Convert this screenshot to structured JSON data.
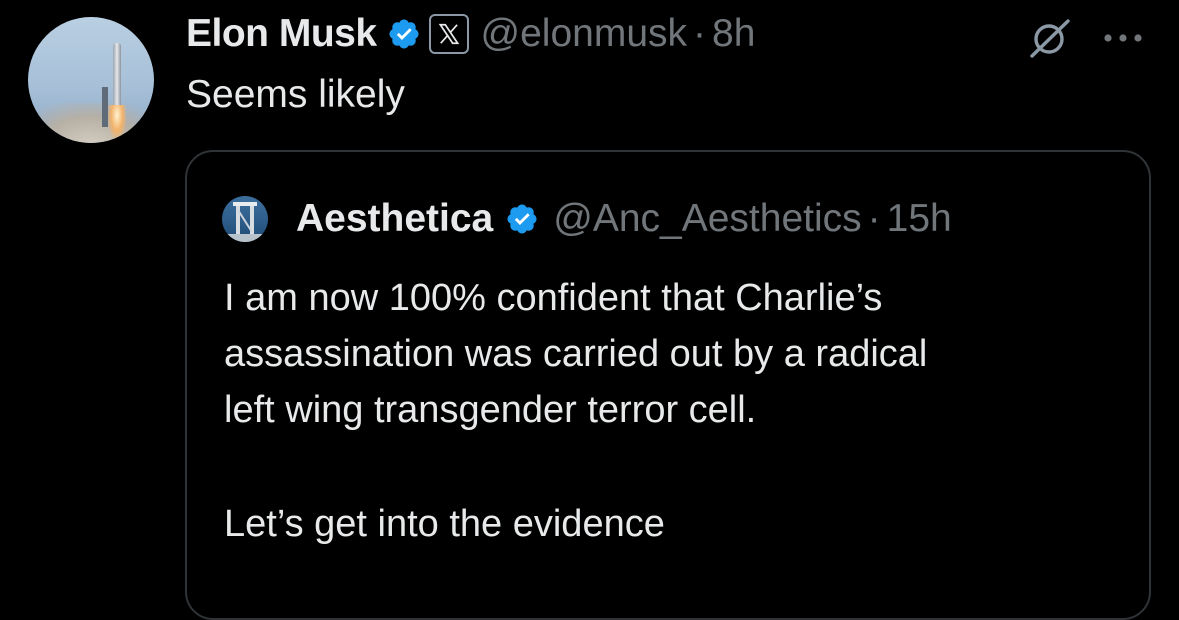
{
  "tweet": {
    "author_name": "Elon Musk",
    "author_handle": "@elonmusk",
    "separator": "·",
    "time": "8h",
    "text": "Seems likely",
    "avatar_icon": "rocket-launch-avatar",
    "verified_icon": "verified-badge-icon",
    "affiliate_icon": "x-logo-icon",
    "grok_icon": "grok-slash-icon",
    "more_icon": "more-dots-icon"
  },
  "quote": {
    "author_name": "Aesthetica",
    "author_handle": "@Anc_Aesthetics",
    "separator": "·",
    "time": "15h",
    "lines": [
      "I am now 100% confident that Charlie’s",
      "assassination was carried out by a radical",
      "left wing transgender terror cell.",
      "Let’s get into the evidence"
    ],
    "avatar_icon": "column-statue-avatar",
    "verified_icon": "verified-badge-icon"
  },
  "colors": {
    "background": "#000000",
    "text": "#e7e9ea",
    "muted": "#71767b",
    "verified": "#1d9bf0",
    "border": "#2f3336"
  }
}
